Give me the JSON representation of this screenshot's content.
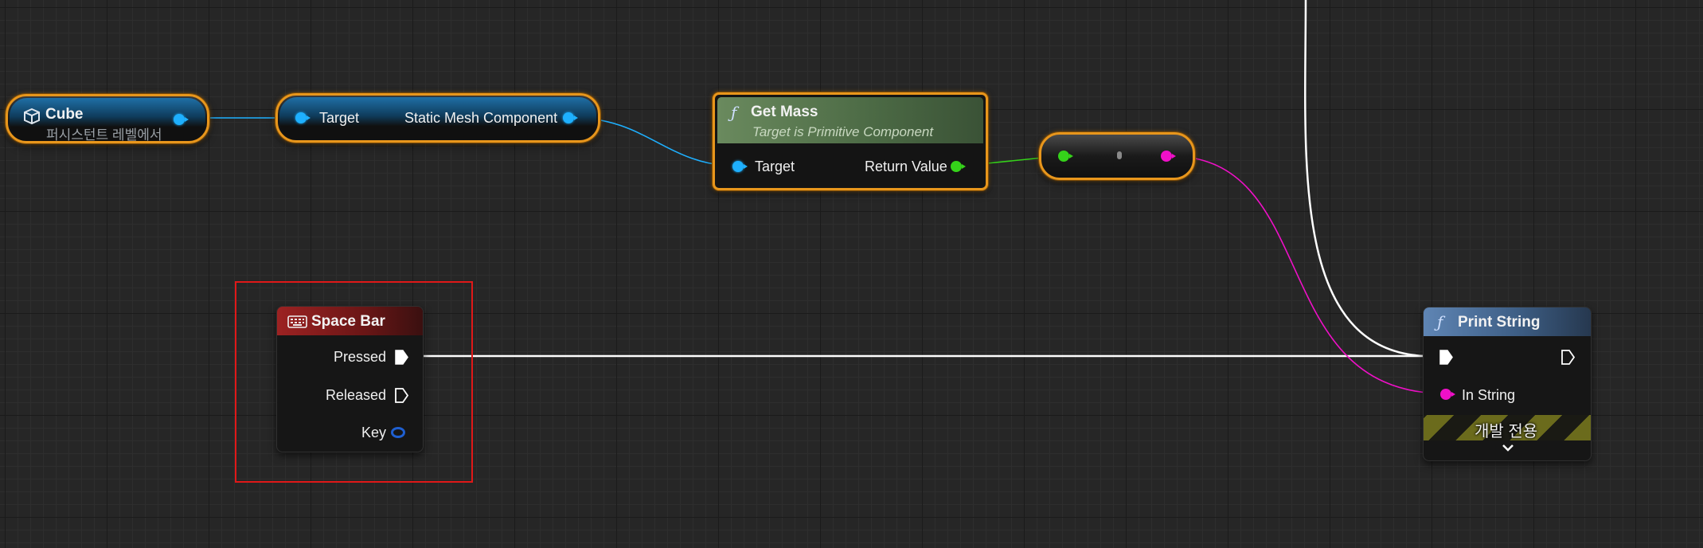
{
  "nodes": {
    "cube": {
      "title": "Cube",
      "subtitle": "퍼시스턴트 레벨에서",
      "icon": "cube-icon"
    },
    "static_mesh_getter": {
      "input_label": "Target",
      "output_label": "Static Mesh Component"
    },
    "get_mass": {
      "title": "Get Mass",
      "subtitle": "Target is Primitive Component",
      "input_label": "Target",
      "output_label": "Return Value",
      "icon": "function-icon"
    },
    "conversion": {
      "icon": "conversion-dot-icon"
    },
    "space_bar": {
      "title": "Space Bar",
      "pins": [
        "Pressed",
        "Released",
        "Key"
      ],
      "icon": "keyboard-icon"
    },
    "print_string": {
      "title": "Print String",
      "in_string_label": "In String",
      "dev_only_label": "개발 전용",
      "icon": "function-icon",
      "expand_icon": "chevron-down-icon"
    }
  },
  "colors": {
    "object_pin": "#1eb0ff",
    "float_pin": "#35d21a",
    "string_pin": "#f010c8",
    "exec_wire": "#ffffff",
    "selection": "#e8961c",
    "highlight_box": "#e01818"
  }
}
